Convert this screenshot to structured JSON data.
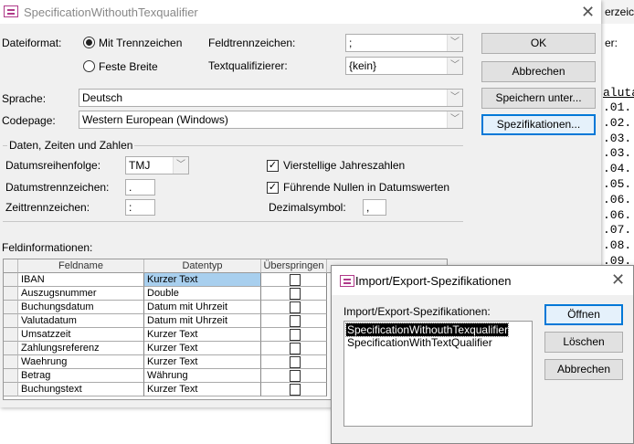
{
  "background_window": {
    "title_fragment": "erzeich",
    "label_fragment": "er:",
    "column_header_fragment": "aluta",
    "date_fragments": [
      ".01.:",
      ".02.:",
      ".03.:",
      ".03.:",
      ".04.:",
      ".05.:",
      ".06.:",
      ".06.:",
      ".07.:",
      ".08.:",
      ".09.:"
    ]
  },
  "main_dialog": {
    "title": "SpecificationWithouthTexqualifier",
    "close": "✕",
    "dateiformat_label": "Dateiformat:",
    "radio_delimited": "Mit Trennzeichen",
    "radio_fixed": "Feste Breite",
    "selected_format": "Mit Trennzeichen",
    "feldtrennzeichen_label": "Feldtrennzeichen:",
    "feldtrennzeichen_value": ";",
    "textqualifizierer_label": "Textqualifizierer:",
    "textqualifizierer_value": "{kein}",
    "sprache_label": "Sprache:",
    "sprache_value": "Deutsch",
    "codepage_label": "Codepage:",
    "codepage_value": "Western European (Windows)",
    "buttons": {
      "ok": "OK",
      "cancel": "Abbrechen",
      "save_as": "Speichern unter...",
      "specs": "Spezifikationen..."
    },
    "group": {
      "title": "Daten, Zeiten und Zahlen",
      "datumsreihenfolge_label": "Datumsreihenfolge:",
      "datumsreihenfolge_value": "TMJ",
      "datumstrennzeichen_label": "Datumstrennzeichen:",
      "datumstrennzeichen_value": ".",
      "zeittrennzeichen_label": "Zeittrennzeichen:",
      "zeittrennzeichen_value": ":",
      "vierstellige_label": "Vierstellige Jahreszahlen",
      "vierstellige_checked": true,
      "fuehrende_label": "Führende Nullen in Datumswerten",
      "fuehrende_checked": true,
      "dezimalsymbol_label": "Dezimalsymbol:",
      "dezimalsymbol_value": ","
    },
    "feldinfo_label": "Feldinformationen:",
    "grid": {
      "headers": [
        "Feldname",
        "Datentyp",
        "Überspringen"
      ],
      "rows": [
        {
          "name": "IBAN",
          "type": "Kurzer Text",
          "skip": false
        },
        {
          "name": "Auszugsnummer",
          "type": "Double",
          "skip": false
        },
        {
          "name": "Buchungsdatum",
          "type": "Datum mit Uhrzeit",
          "skip": false
        },
        {
          "name": "Valutadatum",
          "type": "Datum mit Uhrzeit",
          "skip": false
        },
        {
          "name": "Umsatzzeit",
          "type": "Kurzer Text",
          "skip": false
        },
        {
          "name": "Zahlungsreferenz",
          "type": "Kurzer Text",
          "skip": false
        },
        {
          "name": "Waehrung",
          "type": "Kurzer Text",
          "skip": false
        },
        {
          "name": "Betrag",
          "type": "Währung",
          "skip": false
        },
        {
          "name": "Buchungstext",
          "type": "Kurzer Text",
          "skip": false
        }
      ]
    }
  },
  "spec_dialog": {
    "title": "Import/Export-Spezifikationen",
    "close": "✕",
    "list_label": "Import/Export-Spezifikationen:",
    "items": [
      "SpecificationWithouthTexqualifier",
      "SpecificationWithTextQualifier"
    ],
    "selected_index": 0,
    "buttons": {
      "open": "Öffnen",
      "delete": "Löschen",
      "cancel": "Abbrechen"
    }
  }
}
